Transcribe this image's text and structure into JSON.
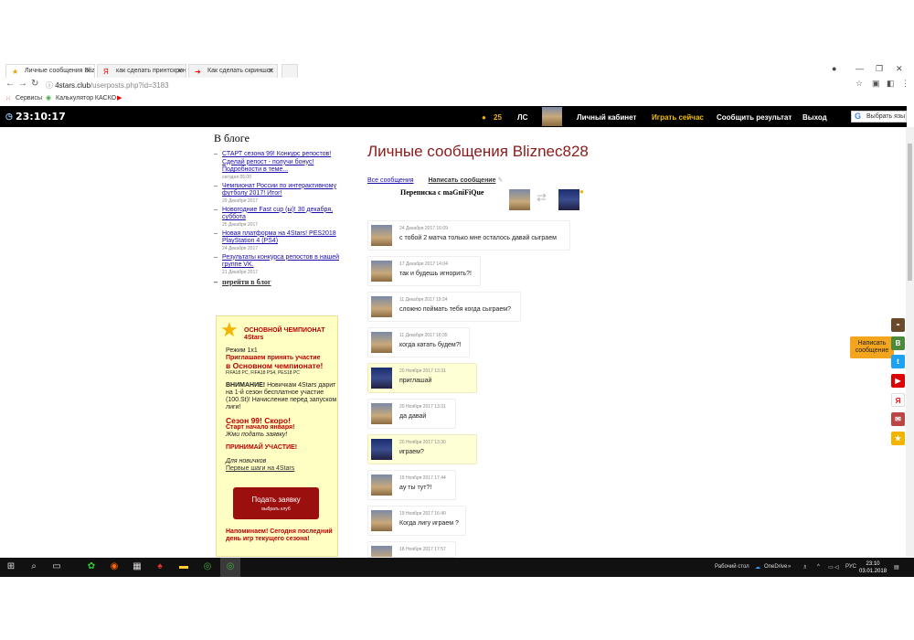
{
  "browser": {
    "tabs": [
      {
        "label": "Личные сообщения Bliz",
        "icon": "star-icon"
      },
      {
        "label": "как сделать принтскрин",
        "icon": "yandex-icon"
      },
      {
        "label": "Как сделать скриншот",
        "icon": "arrow-icon"
      }
    ],
    "url_domain": "4stars.club",
    "url_path": "/userposts.php?id=3183",
    "bookmarks": [
      "Сервисы",
      "Калькулятор КАСКО"
    ]
  },
  "sitebar": {
    "clock": "23:10:17",
    "coins": "25",
    "ls": "ЛС",
    "cabinet": "Личный кабинет",
    "play_now": "Играть сейчас",
    "report": "Сообщить результат",
    "logout": "Выход",
    "translate": "Выбрать язы"
  },
  "blog": {
    "title": "В блоге",
    "items": [
      {
        "text": "СТАРТ сезона 99! Конкурс репостов! Сделай репост - получи бонус! Подробности в теме...",
        "date": "сегодня 05:00"
      },
      {
        "text": "Чемпионат России по интерактивному футболу 2017! Итог!",
        "date": "29 Декабря 2017"
      },
      {
        "text": "Новогодние Fast cup (ы)! 30 декабря, суббота",
        "date": "25 Декабря 2017"
      },
      {
        "text": "Новая платформа на 4Stars! PES2018 PlayStation 4 (PS4)",
        "date": "24 Декабря 2017"
      },
      {
        "text": "Результаты конкурса репостов в нашей группе VK.",
        "date": "21 Декабря 2017"
      }
    ],
    "more": "перейти в блог"
  },
  "promo": {
    "heading": "ОСНОВНОЙ ЧЕМПИОНАТ 4Stars",
    "mode": "Режим 1x1",
    "invite": "Приглашаем принять участие",
    "invite_big": "в Основном чемпионате!",
    "platforms": "FIFA18 PC, FIFA18 PS4, PES18 PC",
    "attention_label": "ВНИМАНИЕ!",
    "attention_text": "Новичкам 4Stars дарит на 1-й сезон бесплатное участие (100.St)! Начисление перед запуском лиги!",
    "season": "Сезон 99! Скоро!",
    "start": "Старт начало января!",
    "apply_hint": "Жми подать заявку!",
    "accept": "ПРИНИМАЙ УЧАСТИЕ!",
    "for_newbies": "Для новичков",
    "first_steps": "Первые шаги на 4Stars",
    "button": "Подать заявку",
    "button_sub": "выбрать клуб",
    "reminder": "Напоминаем! Сегодня последний день игр текущего сезона!"
  },
  "main": {
    "title": "Личные сообщения Bliznec828",
    "all_messages": "Все сообщения",
    "write_message": "Написать сообщение",
    "conversation": "Переписка с maGniFiQue"
  },
  "messages": [
    {
      "date": "24 Декабря 2017 16:09",
      "text": "с тобой 2 матча только мне осталось давай сыграем",
      "mine": false
    },
    {
      "date": "17 Декабря 2017 14:04",
      "text": "так и будешь игнорить?!",
      "mine": false
    },
    {
      "date": "11 Декабря 2017 19:24",
      "text": "сложно поймать тебя когда сыграем?",
      "mine": false
    },
    {
      "date": "11 Декабря 2017 16:35",
      "text": "когда катать будем?!",
      "mine": false
    },
    {
      "date": "20 Ноября 2017 13:31",
      "text": "приглашай",
      "mine": true
    },
    {
      "date": "20 Ноября 2017 13:31",
      "text": "да давай",
      "mine": false
    },
    {
      "date": "20 Ноября 2017 13:30",
      "text": "играем?",
      "mine": true
    },
    {
      "date": "19 Ноября 2017 17:44",
      "text": "ау ты тут?!",
      "mine": false
    },
    {
      "date": "19 Ноября 2017 16:40",
      "text": "Когда лигу играем ?",
      "mine": false
    },
    {
      "date": "18 Ноября 2017 17:57",
      "text": "",
      "mine": false
    }
  ],
  "side_widget": {
    "write": "Написать сообщение"
  },
  "taskbar": {
    "desktop": "Рабочий стол",
    "onedrive": "OneDrive",
    "lang": "РУС",
    "time": "23:10",
    "date": "03.01.2018"
  }
}
